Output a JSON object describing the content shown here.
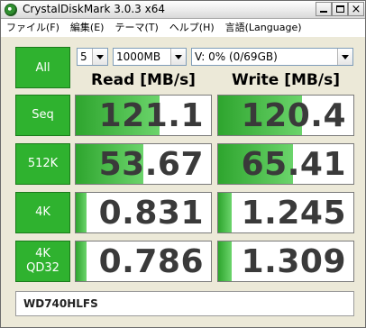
{
  "window": {
    "title": "CrystalDiskMark 3.0.3 x64"
  },
  "titlebar_buttons": {
    "minimize": "",
    "maximize": "",
    "close": "×"
  },
  "menu": [
    {
      "label": "ファイル(F)"
    },
    {
      "label": "編集(E)"
    },
    {
      "label": "テーマ(T)"
    },
    {
      "label": "ヘルプ(H)"
    },
    {
      "label": "言語(Language)"
    }
  ],
  "controls": {
    "all_label": "All",
    "test_count": "5",
    "test_size": "1000MB",
    "drive": "V: 0% (0/69GB)"
  },
  "headers": {
    "read": "Read [MB/s]",
    "write": "Write [MB/s]"
  },
  "colors": {
    "accent_green": "#2fb22f",
    "bar_green": "#4fc44f"
  },
  "rows": [
    {
      "label_line1": "Seq",
      "label_line2": "",
      "read": "121.1",
      "write": "120.4",
      "read_fill": 0.62,
      "write_fill": 0.62
    },
    {
      "label_line1": "512K",
      "label_line2": "",
      "read": "53.67",
      "write": "65.41",
      "read_fill": 0.5,
      "write_fill": 0.55
    },
    {
      "label_line1": "4K",
      "label_line2": "",
      "read": "0.831",
      "write": "1.245",
      "read_fill": 0.08,
      "write_fill": 0.1
    },
    {
      "label_line1": "4K",
      "label_line2": "QD32",
      "read": "0.786",
      "write": "1.309",
      "read_fill": 0.08,
      "write_fill": 0.1
    }
  ],
  "comment": "WD740HLFS"
}
